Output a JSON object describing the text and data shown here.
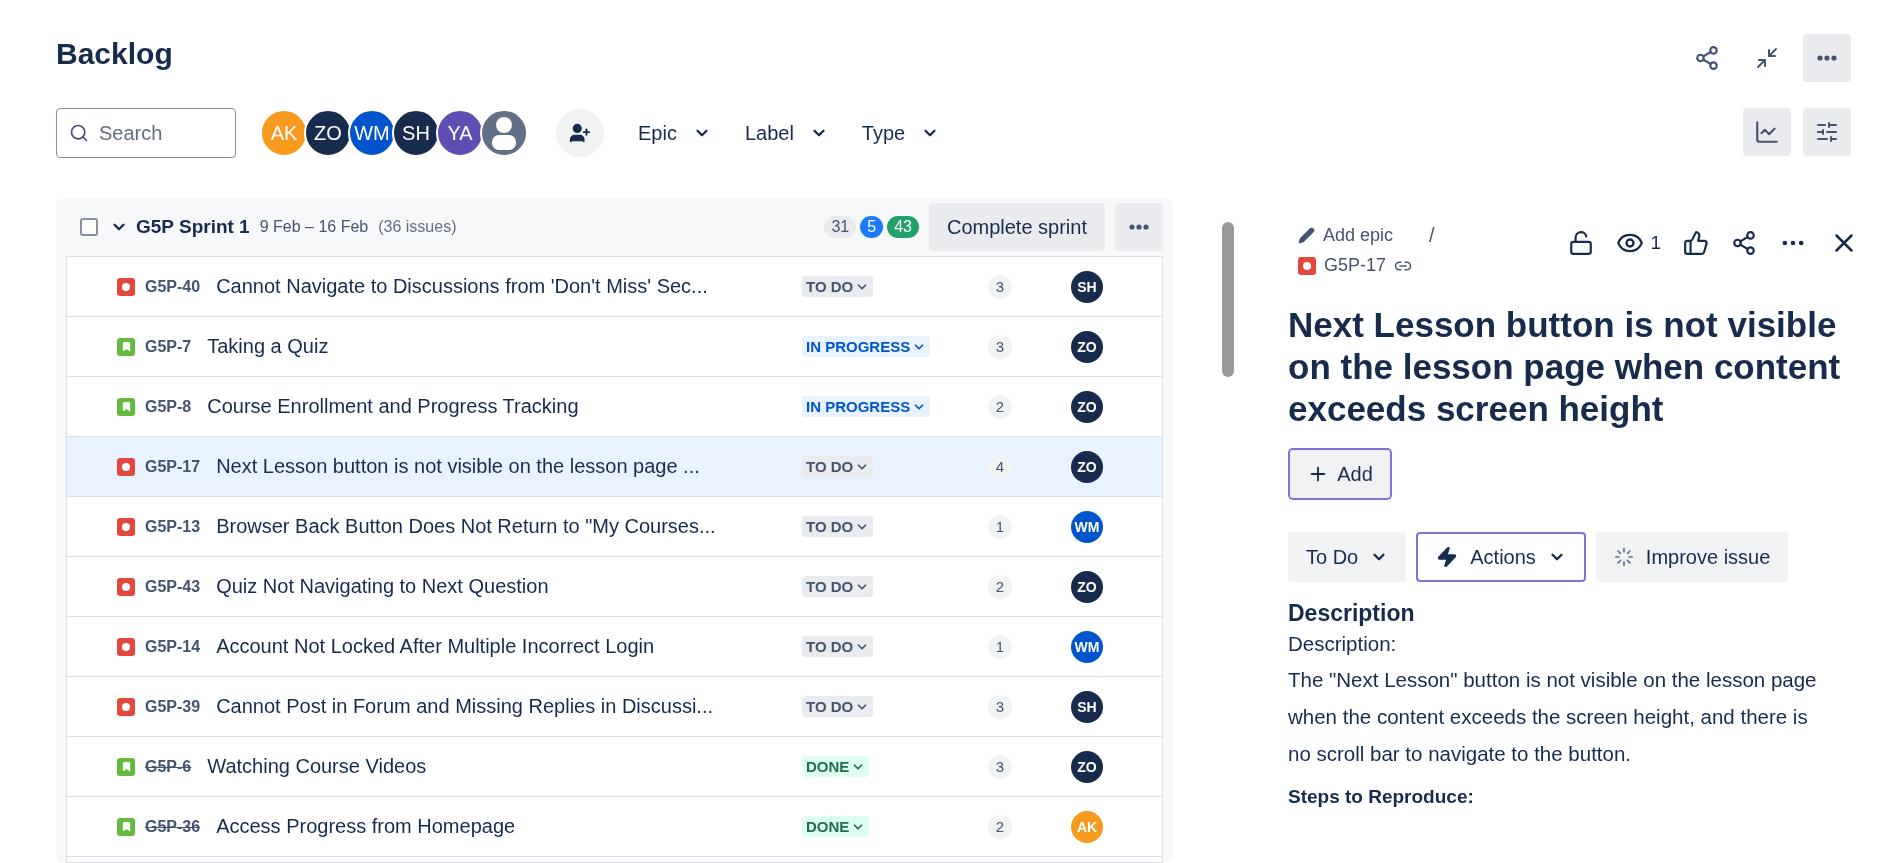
{
  "page_title": "Backlog",
  "search": {
    "placeholder": "Search"
  },
  "people": [
    {
      "initials": "AK",
      "color": "#f79a1f"
    },
    {
      "initials": "ZO",
      "color": "#172b4d"
    },
    {
      "initials": "WM",
      "color": "#0055cc"
    },
    {
      "initials": "SH",
      "color": "#172b4d"
    },
    {
      "initials": "YA",
      "color": "#5e4db2"
    }
  ],
  "filters": [
    "Epic",
    "Label",
    "Type"
  ],
  "sprint": {
    "checked": false,
    "expanded": true,
    "name": "G5P Sprint 1",
    "dates": "9 Feb – 16 Feb",
    "count": "(36 issues)",
    "totals": [
      {
        "value": "31",
        "color": "#e9ebee"
      },
      {
        "value": "5",
        "color": "#1d7afc"
      },
      {
        "value": "43",
        "color": "#22a06b"
      }
    ],
    "complete_label": "Complete sprint"
  },
  "issues": [
    {
      "kind": "bug",
      "key": "G5P-40",
      "resolved": false,
      "summary": "Cannot Navigate to Discussions from 'Don't Miss' Sec...",
      "status": {
        "label": "TO DO",
        "color": "#e9ebee"
      },
      "estimate": "3",
      "assignee": {
        "initials": "SH",
        "color": "#172b4d"
      },
      "selected": false
    },
    {
      "kind": "story",
      "key": "G5P-7",
      "resolved": false,
      "summary": "Taking a Quiz",
      "status": {
        "label": "IN PROGRESS",
        "color": "#e9f2ff"
      },
      "estimate": "3",
      "assignee": {
        "initials": "ZO",
        "color": "#172b4d"
      },
      "selected": false
    },
    {
      "kind": "story",
      "key": "G5P-8",
      "resolved": false,
      "summary": "Course Enrollment and Progress Tracking",
      "status": {
        "label": "IN PROGRESS",
        "color": "#e9f2ff"
      },
      "estimate": "2",
      "assignee": {
        "initials": "ZO",
        "color": "#172b4d"
      },
      "selected": false
    },
    {
      "kind": "bug",
      "key": "G5P-17",
      "resolved": false,
      "summary": "Next Lesson button is not visible on the lesson page ...",
      "status": {
        "label": "TO DO",
        "color": "#e9ebee"
      },
      "estimate": "4",
      "assignee": {
        "initials": "ZO",
        "color": "#172b4d"
      },
      "selected": true
    },
    {
      "kind": "bug",
      "key": "G5P-13",
      "resolved": false,
      "summary": "Browser Back Button Does Not Return to \"My Courses...",
      "status": {
        "label": "TO DO",
        "color": "#e9ebee"
      },
      "estimate": "1",
      "assignee": {
        "initials": "WM",
        "color": "#0055cc"
      },
      "selected": false
    },
    {
      "kind": "bug",
      "key": "G5P-43",
      "resolved": false,
      "summary": "Quiz Not Navigating to Next Question",
      "status": {
        "label": "TO DO",
        "color": "#e9ebee"
      },
      "estimate": "2",
      "assignee": {
        "initials": "ZO",
        "color": "#172b4d"
      },
      "selected": false
    },
    {
      "kind": "bug",
      "key": "G5P-14",
      "resolved": false,
      "summary": "Account Not Locked After Multiple Incorrect Login",
      "status": {
        "label": "TO DO",
        "color": "#e9ebee"
      },
      "estimate": "1",
      "assignee": {
        "initials": "WM",
        "color": "#0055cc"
      },
      "selected": false
    },
    {
      "kind": "bug",
      "key": "G5P-39",
      "resolved": false,
      "summary": "Cannot Post in Forum and Missing Replies in Discussi...",
      "status": {
        "label": "TO DO",
        "color": "#e9ebee"
      },
      "estimate": "3",
      "assignee": {
        "initials": "SH",
        "color": "#172b4d"
      },
      "selected": false
    },
    {
      "kind": "story",
      "key": "G5P-6",
      "resolved": true,
      "summary": "Watching Course Videos",
      "status": {
        "label": "DONE",
        "color": "#dcfff1"
      },
      "estimate": "3",
      "assignee": {
        "initials": "ZO",
        "color": "#172b4d"
      },
      "selected": false
    },
    {
      "kind": "story",
      "key": "G5P-36",
      "resolved": true,
      "summary": "Access Progress from Homepage",
      "status": {
        "label": "DONE",
        "color": "#dcfff1"
      },
      "estimate": "2",
      "assignee": {
        "initials": "AK",
        "color": "#f79a1f"
      },
      "selected": false
    }
  ],
  "detail": {
    "epic_label": "Add epic",
    "separator": "/",
    "watchers": "1",
    "key": "G5P-17",
    "kind": "bug",
    "title": "Next Lesson button is not visible on the lesson page when content exceeds screen height",
    "add_label": "Add",
    "status_label": "To Do",
    "actions_label": "Actions",
    "improve_label": "Improve issue",
    "description_heading": "Description",
    "description_lines": [
      "Description:",
      "The \"Next Lesson\" button is not visible on the lesson page when the content exceeds the screen height, and there is no scroll bar to navigate to the button."
    ],
    "steps_heading": "Steps to Reproduce:"
  }
}
